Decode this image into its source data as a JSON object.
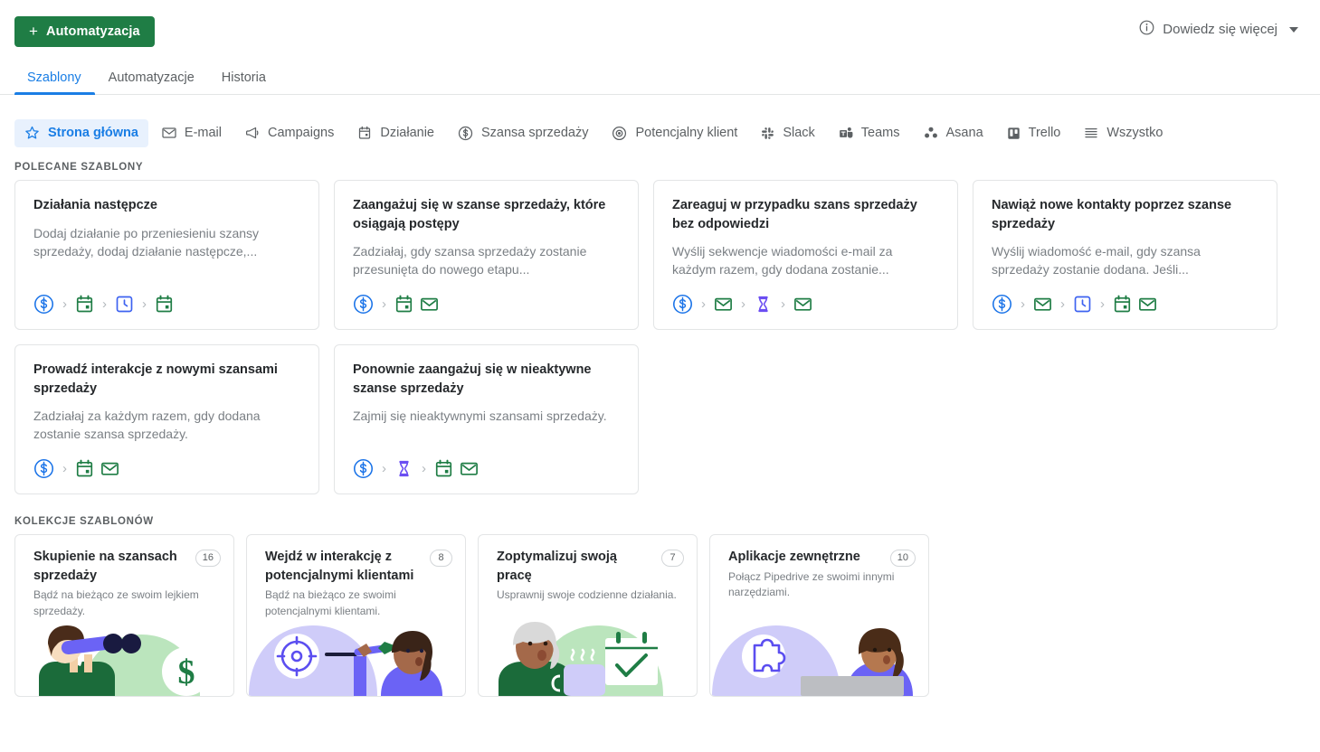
{
  "toolbar": {
    "automation_button": "Automatyzacja",
    "plus_glyph": "+",
    "learn_more": "Dowiedz się więcej",
    "info_icon": "info-circle-icon",
    "caret_icon": "chevron-down-icon"
  },
  "tabs": [
    {
      "label": "Szablony",
      "active": true
    },
    {
      "label": "Automatyzacje",
      "active": false
    },
    {
      "label": "Historia",
      "active": false
    }
  ],
  "filters": [
    {
      "label": "Strona główna",
      "icon": "star-icon",
      "active": true
    },
    {
      "label": "E-mail",
      "icon": "envelope-icon",
      "active": false
    },
    {
      "label": "Campaigns",
      "icon": "megaphone-icon",
      "active": false
    },
    {
      "label": "Działanie",
      "icon": "calendar-icon",
      "active": false
    },
    {
      "label": "Szansa sprzedaży",
      "icon": "dollar-circle-icon",
      "active": false
    },
    {
      "label": "Potencjalny klient",
      "icon": "target-icon",
      "active": false
    },
    {
      "label": "Slack",
      "icon": "slack-icon",
      "active": false
    },
    {
      "label": "Teams",
      "icon": "teams-icon",
      "active": false
    },
    {
      "label": "Asana",
      "icon": "asana-icon",
      "active": false
    },
    {
      "label": "Trello",
      "icon": "trello-icon",
      "active": false
    },
    {
      "label": "Wszystko",
      "icon": "list-icon",
      "active": false
    }
  ],
  "sections": {
    "featured_title": "POLECANE SZABLONY",
    "collections_title": "KOLEKCJE SZABLONÓW"
  },
  "templates": [
    {
      "title": "Działania następcze",
      "desc": "Dodaj działanie po przeniesieniu szansy sprzedaży, dodaj działanie następcze,...",
      "steps": [
        "deal",
        "activity",
        "delay",
        "activity"
      ]
    },
    {
      "title": "Zaangażuj się w szanse sprzedaży, które osiągają postępy",
      "desc": "Zadziałaj, gdy szansa sprzedaży zostanie przesunięta do nowego etapu...",
      "steps": [
        "deal",
        "activity",
        "email-nogap"
      ]
    },
    {
      "title": "Zareaguj w przypadku szans sprzedaży bez odpowiedzi",
      "desc": "Wyślij sekwencje wiadomości e-mail za każdym razem, gdy dodana zostanie...",
      "steps": [
        "deal",
        "email",
        "hourglass",
        "email"
      ]
    },
    {
      "title": "Nawiąż nowe kontakty poprzez szanse sprzedaży",
      "desc": "Wyślij wiadomość e-mail, gdy szansa sprzedaży zostanie dodana. Jeśli...",
      "steps": [
        "deal",
        "email",
        "delay",
        "activity",
        "email-nogap"
      ]
    },
    {
      "title": "Prowadź interakcje z nowymi szansami sprzedaży",
      "desc": "Zadziałaj za każdym razem, gdy dodana zostanie szansa sprzedaży.",
      "steps": [
        "deal",
        "activity",
        "email-nogap"
      ]
    },
    {
      "title": "Ponownie zaangażuj się w nieaktywne szanse sprzedaży",
      "desc": "Zajmij się nieaktywnymi szansami sprzedaży.",
      "steps": [
        "deal",
        "hourglass",
        "activity",
        "email-nogap"
      ]
    }
  ],
  "collections": [
    {
      "title": "Skupienie na szansach sprzedaży",
      "count": "16",
      "desc": "Bądź na bieżąco ze swoim lejkiem sprzedaży.",
      "art": "binoculars"
    },
    {
      "title": "Wejdź w interakcję z potencjalnymi klientami",
      "count": "8",
      "desc": "Bądź na bieżąco ze swoimi potencjalnymi klientami.",
      "art": "dart"
    },
    {
      "title": "Zoptymalizuj swoją pracę",
      "count": "7",
      "desc": "Usprawnij swoje codzienne działania.",
      "art": "coffee"
    },
    {
      "title": "Aplikacje zewnętrzne",
      "count": "10",
      "desc": "Połącz Pipedrive ze swoimi innymi narzędziami.",
      "art": "puzzle"
    }
  ],
  "colors": {
    "brand_green": "#1f7d45",
    "accent_blue": "#1a7ee5",
    "icon_green": "#1f7d45",
    "icon_blue": "#3d62f0",
    "icon_purple": "#6b4ef2",
    "text_muted": "#7a7f84"
  }
}
